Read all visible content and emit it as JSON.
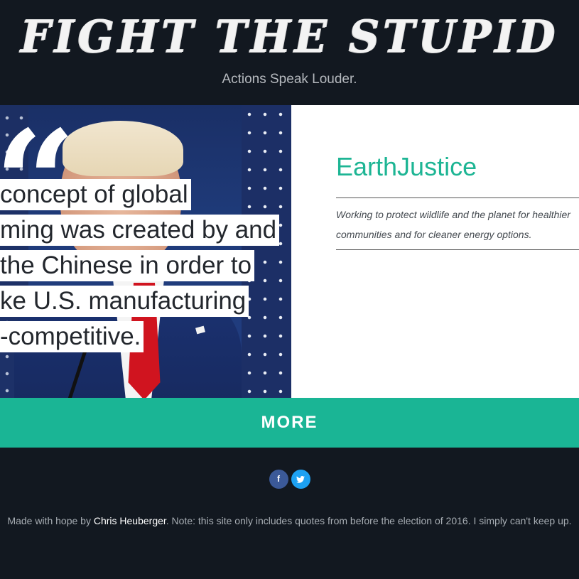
{
  "header": {
    "logo_text": "Fight the Stupid",
    "tagline": "Actions Speak Louder."
  },
  "quote": {
    "mark": "“",
    "lines": [
      "concept of global",
      "ming was created by and",
      "the Chinese in order to",
      "ke U.S. manufacturing",
      "-competitive."
    ]
  },
  "org": {
    "name": "EarthJustice",
    "description": "Working to protect wildlife and the planet for healthier communities and for cleaner energy options."
  },
  "more_button": {
    "label": "MORE"
  },
  "social": {
    "facebook_glyph": "f",
    "twitter_glyph": "t"
  },
  "footer": {
    "prefix": "Made with hope by ",
    "author": "Chris Heuberger",
    "suffix": ". Note: this site only includes quotes from before the election of 2016. I simply can't keep up."
  },
  "colors": {
    "background": "#121820",
    "accent": "#1ab595",
    "facebook": "#3b5998",
    "twitter": "#1da1f2"
  }
}
